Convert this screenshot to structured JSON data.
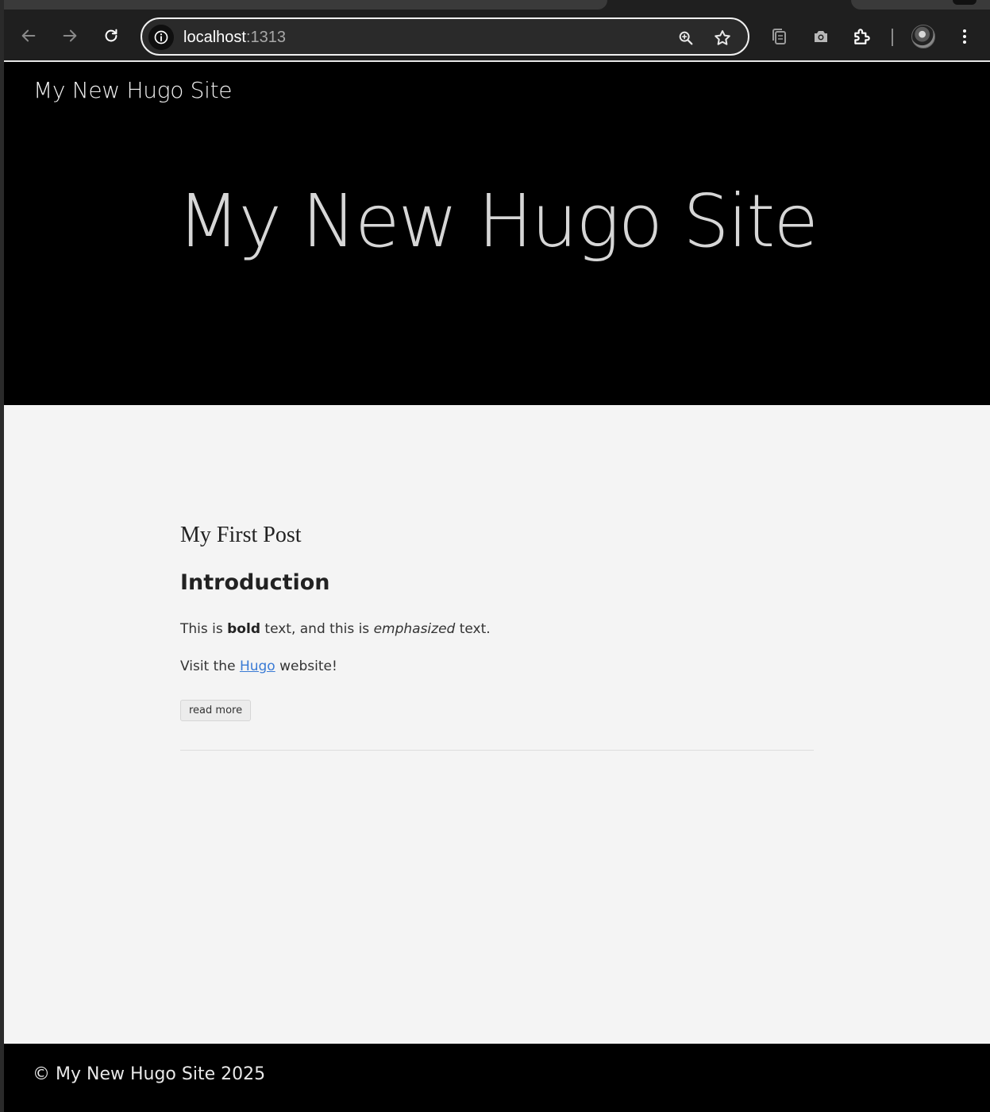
{
  "browser": {
    "url_host": "localhost",
    "url_port": ":1313",
    "icons": [
      "back-icon",
      "forward-icon",
      "reload-icon",
      "site-info-icon",
      "zoom-icon",
      "bookmark-star-icon",
      "tab-search-icon",
      "screenshot-icon",
      "extensions-icon",
      "profile-avatar",
      "more-menu-icon"
    ]
  },
  "site": {
    "nav_title": "My New Hugo Site",
    "hero_title": "My New Hugo Site"
  },
  "post": {
    "title": "My First Post",
    "heading": "Introduction",
    "para1": {
      "t1": "This is ",
      "bold": "bold",
      "t2": " text, and this is ",
      "em": "emphasized",
      "t3": " text."
    },
    "para2": {
      "t1": "Visit the ",
      "link": "Hugo",
      "t2": " website!"
    },
    "read_more_label": "read more"
  },
  "footer": {
    "text": "© My New Hugo Site 2025"
  },
  "colors": {
    "hero_bg": "#000000",
    "page_bg": "#f4f4f4",
    "link": "#3a7bd5",
    "browser_chrome": "#1f1f1f"
  }
}
